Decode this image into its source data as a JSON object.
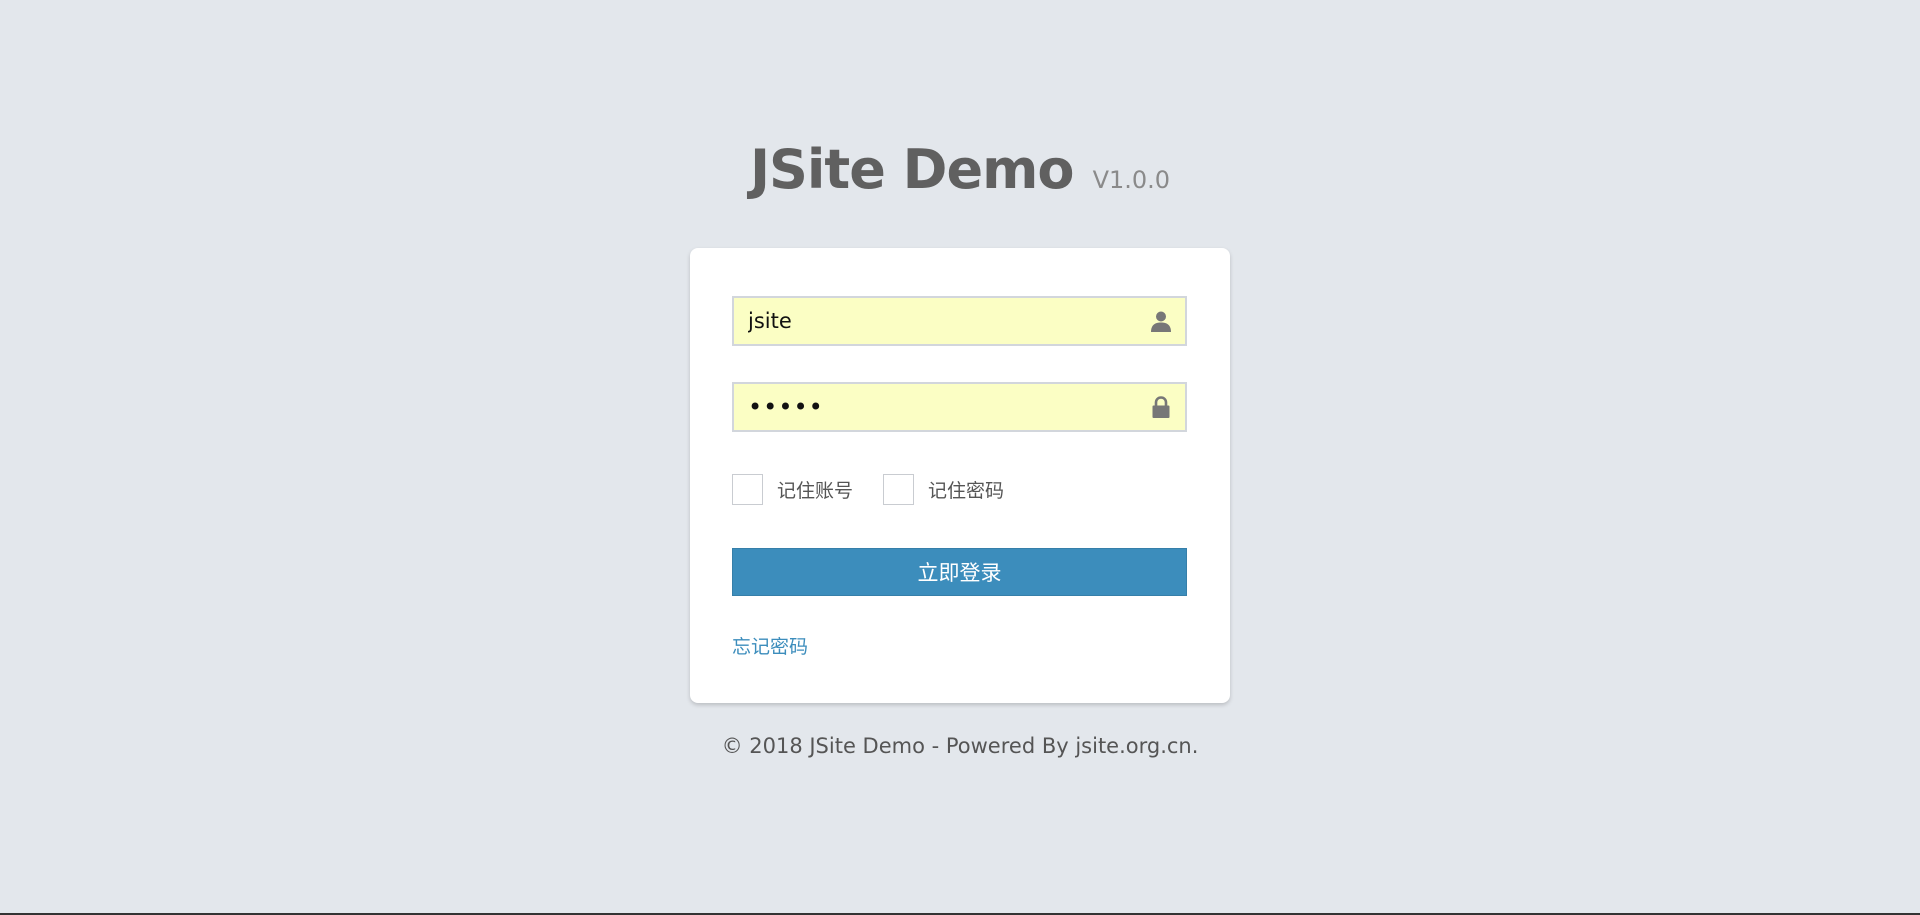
{
  "header": {
    "title": "JSite Demo",
    "version": "V1.0.0"
  },
  "form": {
    "username": {
      "value": "jsite",
      "icon": "user-icon"
    },
    "password": {
      "value": "•••••",
      "icon": "lock-icon"
    },
    "remember_account": {
      "label": "记住账号",
      "checked": false
    },
    "remember_password": {
      "label": "记住密码",
      "checked": false
    },
    "submit_label": "立即登录",
    "forgot_label": "忘记密码"
  },
  "footer": {
    "text": "© 2018 JSite Demo - Powered By jsite.org.cn."
  },
  "colors": {
    "background": "#e3e7ec",
    "input_autofill": "#fbfec4",
    "primary": "#3c8dbc",
    "title": "#606060"
  }
}
